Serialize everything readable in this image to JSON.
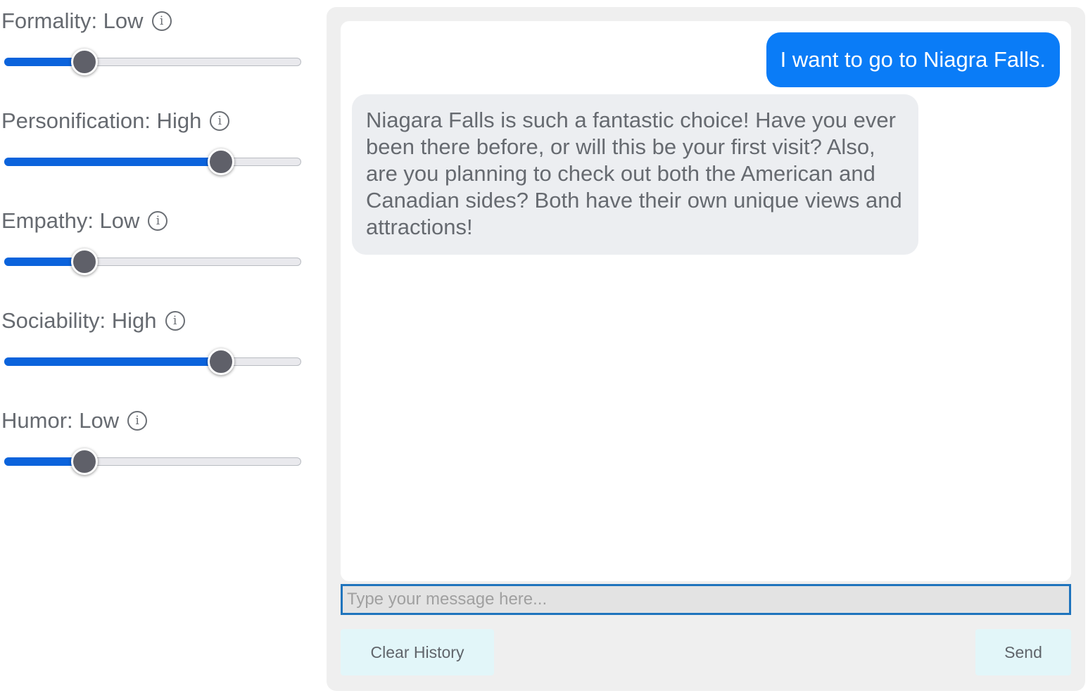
{
  "sliders": [
    {
      "label": "Formality: Low",
      "value": 0.27
    },
    {
      "label": "Personification: High",
      "value": 0.73
    },
    {
      "label": "Empathy: Low",
      "value": 0.27
    },
    {
      "label": "Sociability: High",
      "value": 0.73
    },
    {
      "label": "Humor: Low",
      "value": 0.27
    }
  ],
  "icons": {
    "info": "info-circle-icon",
    "info_glyph": "i"
  },
  "chat": {
    "messages": [
      {
        "role": "user",
        "text": "I want to go to Niagra Falls."
      },
      {
        "role": "assistant",
        "text": "Niagara Falls is such a fantastic choice! Have you ever been there before, or will this be your first visit? Also, are you planning to check out both the American and Canadian sides? Both have their own unique views and attractions!"
      }
    ],
    "input_value": "",
    "input_placeholder": "Type your message here...",
    "clear_label": "Clear History",
    "send_label": "Send"
  },
  "colors": {
    "accent": "#0a7cf7",
    "slider_fill": "#0b63dc",
    "button_bg": "#e2f6f9",
    "input_border": "#1f74bd"
  }
}
